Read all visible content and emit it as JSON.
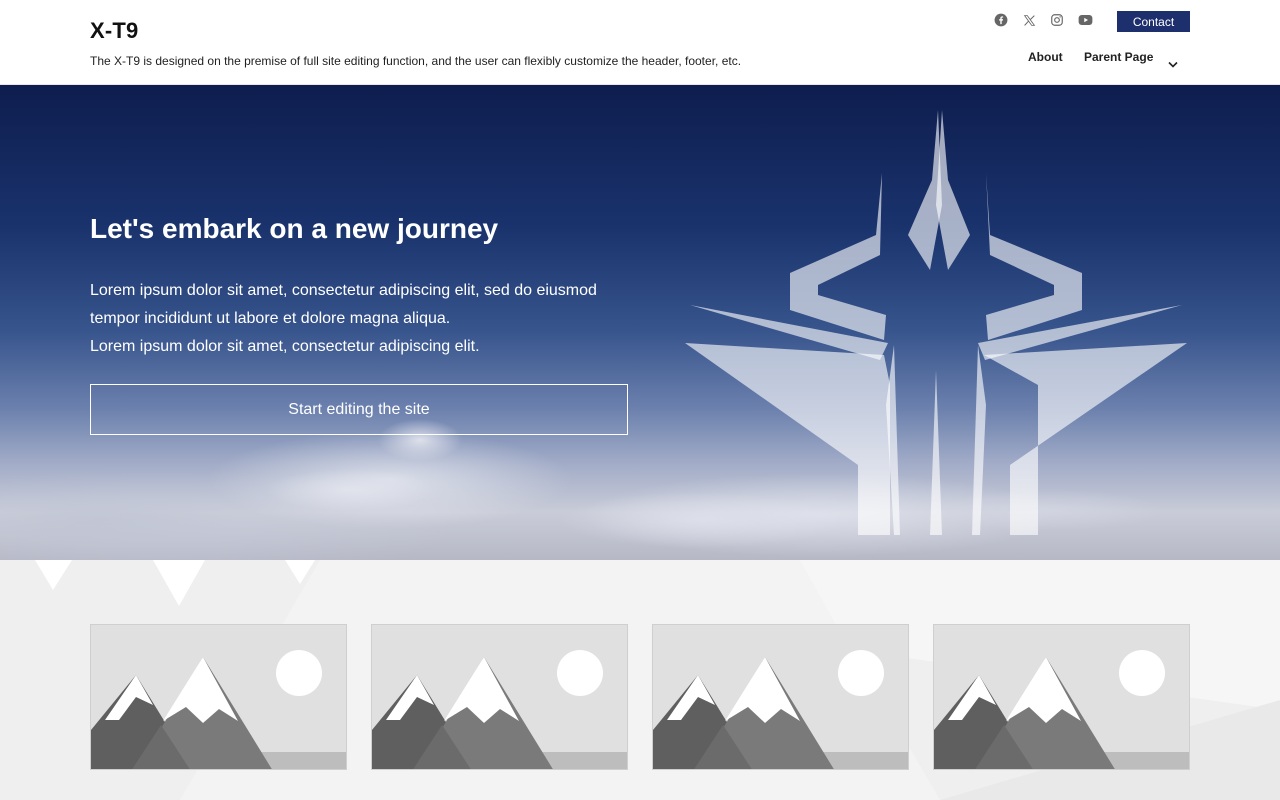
{
  "site": {
    "title": "X-T9",
    "tagline": "The X-T9 is designed on the premise of full site editing function, and the user can flexibly customize the header, footer, etc."
  },
  "header": {
    "social": [
      {
        "icon": "facebook-icon"
      },
      {
        "icon": "x-twitter-icon"
      },
      {
        "icon": "instagram-icon"
      },
      {
        "icon": "youtube-icon"
      }
    ],
    "contact_label": "Contact",
    "nav": [
      {
        "label": "About"
      },
      {
        "label": "Parent Page",
        "has_submenu": true
      }
    ]
  },
  "hero": {
    "title": "Let's embark on a new journey",
    "lines": [
      "Lorem ipsum dolor sit amet, consectetur adipiscing elit, sed do eiusmod",
      "tempor incididunt ut labore et dolore magna aliqua.",
      "Lorem ipsum dolor sit amet, consectetur adipiscing elit."
    ],
    "button_label": "Start editing the site"
  },
  "cards": [
    {
      "image": "placeholder-image"
    },
    {
      "image": "placeholder-image"
    },
    {
      "image": "placeholder-image"
    },
    {
      "image": "placeholder-image"
    }
  ],
  "colors": {
    "accent": "#1e2f6e",
    "hero_top": "#0e1d4e",
    "text": "#111111",
    "social_icon": "#666666"
  }
}
